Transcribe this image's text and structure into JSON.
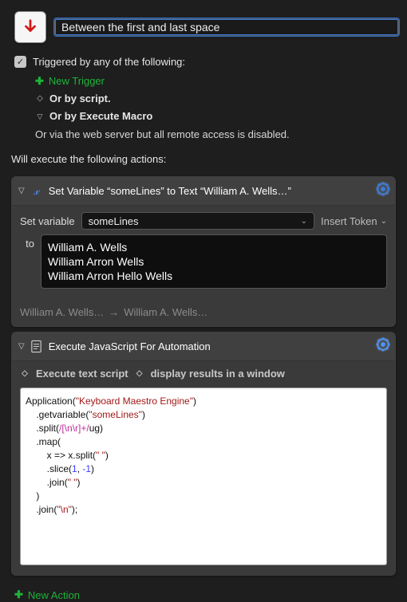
{
  "macro": {
    "name": "Between the first and last space"
  },
  "triggers": {
    "heading": "Triggered by any of the following:",
    "new_trigger": "New Trigger",
    "or_script": "Or by script.",
    "or_execute_macro": "Or by Execute Macro",
    "via_web": "Or via the web server but all remote access is disabled."
  },
  "exec_heading": "Will execute the following actions:",
  "action1": {
    "title": "Set Variable “someLines” to Text “William A. Wells…”",
    "set_variable_label": "Set variable",
    "variable_name": "someLines",
    "insert_token": "Insert Token",
    "to_label": "to",
    "text_line1": "William A. Wells",
    "text_line2": "William Arron Wells",
    "text_line3": "William Arron Hello Wells",
    "footer_left": "William A. Wells…",
    "footer_arrow": "→",
    "footer_right": "William A. Wells…"
  },
  "action2": {
    "title": "Execute JavaScript For Automation",
    "execute_text_script": "Execute text script",
    "display_results": "display results in a window"
  },
  "code": {
    "l1a": "Application(",
    "l1b": "\"Keyboard Maestro Engine\"",
    "l1c": ")",
    "l2a": "    .getvariable(",
    "l2b": "\"someLines\"",
    "l2c": ")",
    "l3a": "    .split(",
    "l3b": "/[\\n\\r]+/",
    "l3c": "ug)",
    "l4": "    .map(",
    "l5a": "        x => x.split(",
    "l5b": "\" \"",
    "l5c": ")",
    "l6a": "        .slice(",
    "l6b": "1",
    "l6c": ", ",
    "l6d": "-1",
    "l6e": ")",
    "l7a": "        .join(",
    "l7b": "\" \"",
    "l7c": ")",
    "l8": "    )",
    "l9a": "    .join(",
    "l9b": "\"\\n\"",
    "l9c": ");"
  },
  "new_action": "New Action"
}
